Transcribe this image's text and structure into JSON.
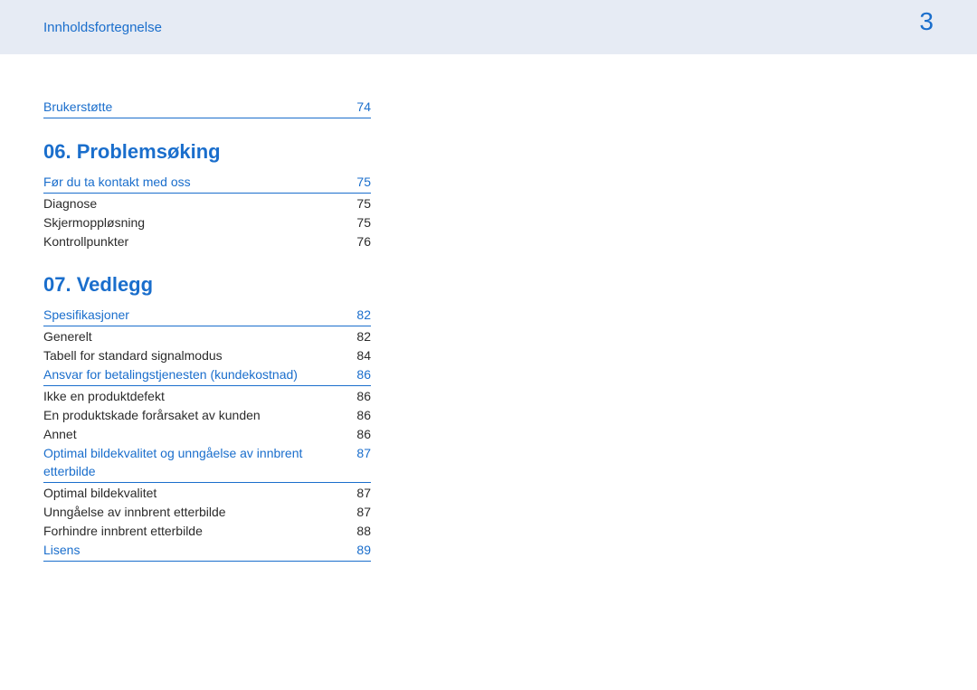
{
  "colors": {
    "accent": "#1a6ecc",
    "header_bg": "#e6ebf4",
    "body_text": "#2b2b2b"
  },
  "header": {
    "title": "Innholdsfortegnelse",
    "page_number": "3"
  },
  "toc": {
    "top_links": [
      {
        "label": "Brukerstøtte",
        "page": "74"
      }
    ],
    "sections": [
      {
        "heading": "06. Problemsøking",
        "groups": [
          {
            "link": {
              "label": "Før du ta kontakt med oss",
              "page": "75"
            },
            "items": [
              {
                "label": "Diagnose",
                "page": "75"
              },
              {
                "label": "Skjermoppløsning",
                "page": "75"
              },
              {
                "label": "Kontrollpunkter",
                "page": "76"
              }
            ]
          }
        ]
      },
      {
        "heading": "07.  Vedlegg",
        "groups": [
          {
            "link": {
              "label": "Spesifikasjoner",
              "page": "82"
            },
            "items": [
              {
                "label": "Generelt",
                "page": "82"
              },
              {
                "label": "Tabell for standard signalmodus",
                "page": "84"
              }
            ]
          },
          {
            "link": {
              "label": "Ansvar for betalingstjenesten (kundekostnad)",
              "page": "86"
            },
            "items": [
              {
                "label": "Ikke en produktdefekt",
                "page": "86"
              },
              {
                "label": "En produktskade forårsaket av kunden",
                "page": "86"
              },
              {
                "label": "Annet",
                "page": "86"
              }
            ]
          },
          {
            "link": {
              "label": "Optimal bildekvalitet og unngåelse av innbrent etterbilde",
              "page": "87"
            },
            "items": [
              {
                "label": "Optimal bildekvalitet",
                "page": "87"
              },
              {
                "label": "Unngåelse av innbrent etterbilde",
                "page": "87"
              },
              {
                "label": "Forhindre innbrent etterbilde",
                "page": "88"
              }
            ]
          },
          {
            "link": {
              "label": "Lisens",
              "page": "89"
            },
            "items": []
          }
        ]
      }
    ]
  }
}
